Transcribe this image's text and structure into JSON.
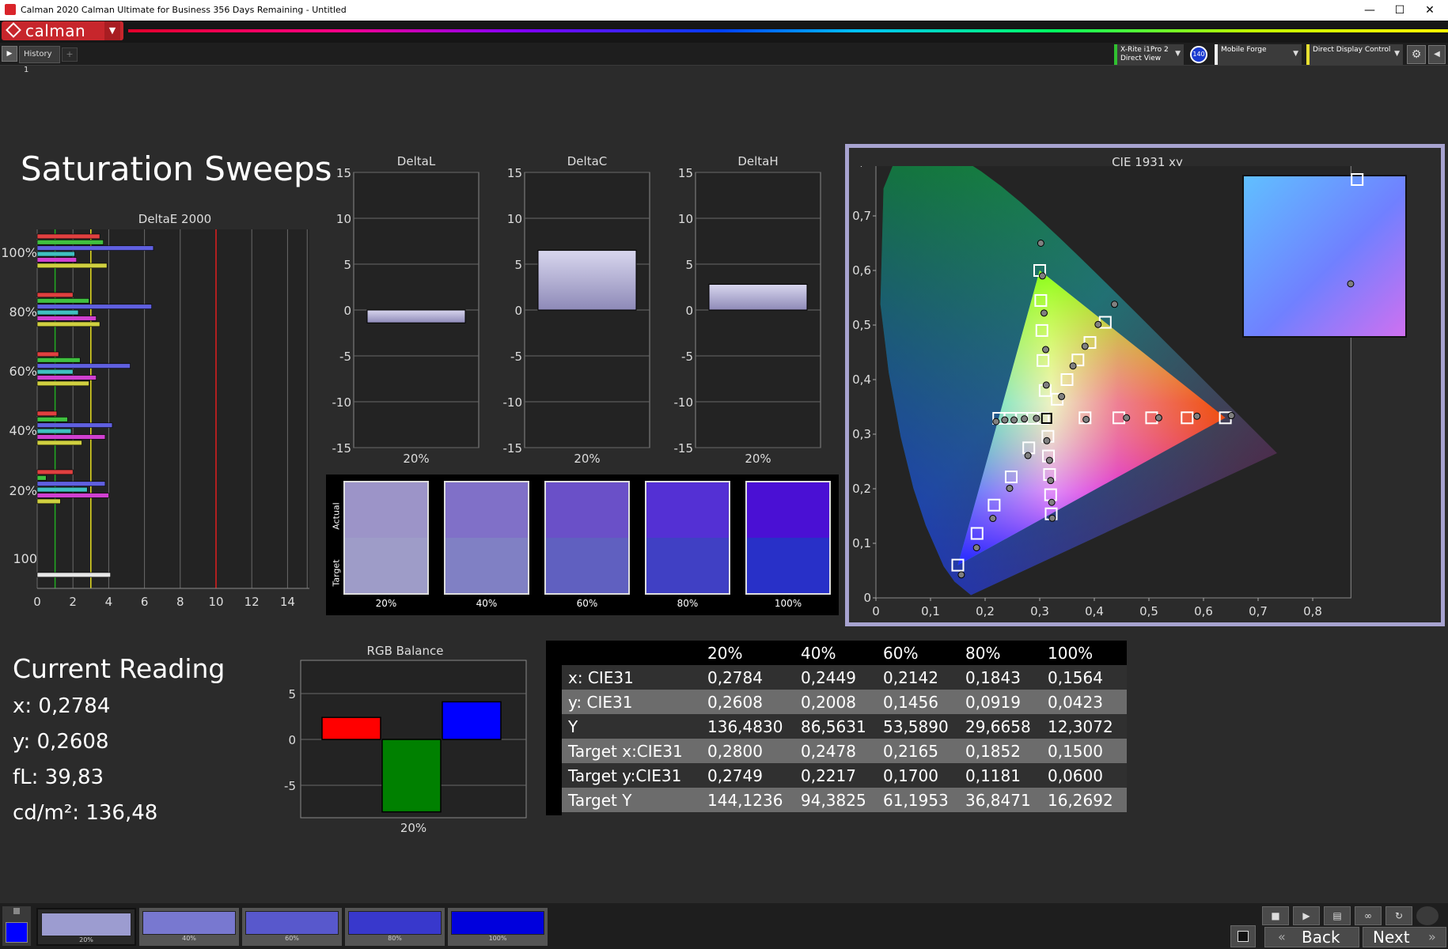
{
  "window": {
    "title": "Calman 2020 Calman Ultimate for Business 356 Days Remaining - Untitled",
    "minimize": "—",
    "maximize": "☐",
    "close": "✕"
  },
  "menubar": {
    "logo_text": "calman"
  },
  "tabbar": {
    "play": "▶",
    "tab_label": "History 1",
    "add": "+"
  },
  "devices": {
    "meter_line1": "X-Rite i1Pro 2",
    "meter_line2": "Direct View",
    "meter_badge": "140",
    "source": "Mobile Forge",
    "display": "Direct Display Control",
    "dropdown_glyph": "▼",
    "settings_glyph": "⚙",
    "collapse_glyph": "◀"
  },
  "page": {
    "title": "Saturation Sweeps"
  },
  "colors": {
    "accent_red": "#d9242a",
    "panel_border": "#a7a3d0",
    "target_swatch": "#0000ff"
  },
  "deltae_chart": {
    "title": "DeltaE 2000",
    "x_ticks": [
      "0",
      "2",
      "4",
      "6",
      "8",
      "10",
      "12",
      "14"
    ],
    "y_labels": [
      "100%",
      "80%",
      "60%",
      "40%",
      "20%",
      "100"
    ],
    "thresholds": [
      1,
      3,
      10
    ],
    "groups": [
      {
        "label": "100%",
        "bars": [
          {
            "c": "#e04040",
            "v": 3.5
          },
          {
            "c": "#40c040",
            "v": 3.7
          },
          {
            "c": "#6060e0",
            "v": 6.5
          },
          {
            "c": "#40c0c0",
            "v": 2.1
          },
          {
            "c": "#d040d0",
            "v": 2.2
          },
          {
            "c": "#d0d040",
            "v": 3.9
          }
        ]
      },
      {
        "label": "80%",
        "bars": [
          {
            "c": "#e04040",
            "v": 2.0
          },
          {
            "c": "#40c040",
            "v": 2.9
          },
          {
            "c": "#6060e0",
            "v": 6.4
          },
          {
            "c": "#40c0c0",
            "v": 2.3
          },
          {
            "c": "#d040d0",
            "v": 3.3
          },
          {
            "c": "#d0d040",
            "v": 3.5
          }
        ]
      },
      {
        "label": "60%",
        "bars": [
          {
            "c": "#e04040",
            "v": 1.2
          },
          {
            "c": "#40c040",
            "v": 2.4
          },
          {
            "c": "#6060e0",
            "v": 5.2
          },
          {
            "c": "#40c0c0",
            "v": 2.0
          },
          {
            "c": "#d040d0",
            "v": 3.3
          },
          {
            "c": "#d0d040",
            "v": 2.9
          }
        ]
      },
      {
        "label": "40%",
        "bars": [
          {
            "c": "#e04040",
            "v": 1.1
          },
          {
            "c": "#40c040",
            "v": 1.7
          },
          {
            "c": "#6060e0",
            "v": 4.2
          },
          {
            "c": "#40c0c0",
            "v": 1.9
          },
          {
            "c": "#d040d0",
            "v": 3.8
          },
          {
            "c": "#d0d040",
            "v": 2.5
          }
        ]
      },
      {
        "label": "20%",
        "bars": [
          {
            "c": "#e04040",
            "v": 2.0
          },
          {
            "c": "#40c040",
            "v": 0.5
          },
          {
            "c": "#6060e0",
            "v": 3.8
          },
          {
            "c": "#40c0c0",
            "v": 2.8
          },
          {
            "c": "#d040d0",
            "v": 4.0
          },
          {
            "c": "#d0d040",
            "v": 1.3
          }
        ]
      },
      {
        "label": "100",
        "bars": [
          {
            "c": "#e8e8e8",
            "v": 4.1
          }
        ]
      }
    ]
  },
  "delta_charts": [
    {
      "title": "DeltaL",
      "value": -1.4,
      "category": "20%",
      "y_ticks": [
        "15",
        "10",
        "5",
        "0",
        "-5",
        "-10",
        "-15"
      ]
    },
    {
      "title": "DeltaC",
      "value": 6.5,
      "category": "20%",
      "y_ticks": [
        "15",
        "10",
        "5",
        "0",
        "-5",
        "-10",
        "-15"
      ]
    },
    {
      "title": "DeltaH",
      "value": 2.8,
      "category": "20%",
      "y_ticks": [
        "15",
        "10",
        "5",
        "0",
        "-5",
        "-10",
        "-15"
      ]
    }
  ],
  "swatches": {
    "actual_label": "Actual",
    "target_label": "Target",
    "items": [
      {
        "label": "20%",
        "actual": "#9c94c8",
        "target": "#9e9cc8"
      },
      {
        "label": "40%",
        "actual": "#8070c8",
        "target": "#8080c4"
      },
      {
        "label": "60%",
        "actual": "#6a50c8",
        "target": "#6060c0"
      },
      {
        "label": "80%",
        "actual": "#5430d4",
        "target": "#4040c4"
      },
      {
        "label": "100%",
        "actual": "#4a10d4",
        "target": "#2830c8"
      }
    ]
  },
  "cie": {
    "title": "CIE 1931 xy",
    "x_ticks": [
      "0",
      "0,1",
      "0,2",
      "0,3",
      "0,4",
      "0,5",
      "0,6",
      "0,7",
      "0,8"
    ],
    "y_ticks": [
      "0",
      "0,1",
      "0,2",
      "0,3",
      "0,4",
      "0,5",
      "0,6",
      "0,7",
      "0,8"
    ],
    "gamut": [
      [
        0.64,
        0.33
      ],
      [
        0.3,
        0.6
      ],
      [
        0.15,
        0.06
      ]
    ],
    "white": [
      0.3127,
      0.329
    ],
    "targets": [
      [
        0.28,
        0.2749
      ],
      [
        0.2478,
        0.2217
      ],
      [
        0.2165,
        0.17
      ],
      [
        0.1852,
        0.1181
      ],
      [
        0.15,
        0.06
      ],
      [
        0.64,
        0.33
      ],
      [
        0.57,
        0.33
      ],
      [
        0.505,
        0.33
      ],
      [
        0.445,
        0.33
      ],
      [
        0.383,
        0.33
      ],
      [
        0.3,
        0.6
      ],
      [
        0.302,
        0.545
      ],
      [
        0.304,
        0.49
      ],
      [
        0.306,
        0.435
      ],
      [
        0.31,
        0.38
      ],
      [
        0.42,
        0.505
      ],
      [
        0.392,
        0.468
      ],
      [
        0.37,
        0.436
      ],
      [
        0.35,
        0.4
      ],
      [
        0.332,
        0.364
      ],
      [
        0.225,
        0.329
      ],
      [
        0.246,
        0.329
      ],
      [
        0.267,
        0.329
      ],
      [
        0.287,
        0.329
      ],
      [
        0.306,
        0.329
      ],
      [
        0.321,
        0.154
      ],
      [
        0.32,
        0.189
      ],
      [
        0.318,
        0.226
      ],
      [
        0.316,
        0.26
      ],
      [
        0.315,
        0.296
      ]
    ],
    "actuals": [
      [
        0.2784,
        0.2608
      ],
      [
        0.2449,
        0.2008
      ],
      [
        0.2142,
        0.1456
      ],
      [
        0.1843,
        0.0919
      ],
      [
        0.1564,
        0.0423
      ],
      [
        0.651,
        0.334
      ],
      [
        0.588,
        0.333
      ],
      [
        0.518,
        0.33
      ],
      [
        0.459,
        0.33
      ],
      [
        0.385,
        0.327
      ],
      [
        0.302,
        0.65
      ],
      [
        0.305,
        0.59
      ],
      [
        0.308,
        0.522
      ],
      [
        0.311,
        0.455
      ],
      [
        0.312,
        0.39
      ],
      [
        0.437,
        0.538
      ],
      [
        0.407,
        0.501
      ],
      [
        0.383,
        0.461
      ],
      [
        0.361,
        0.425
      ],
      [
        0.34,
        0.369
      ],
      [
        0.22,
        0.323
      ],
      [
        0.236,
        0.326
      ],
      [
        0.253,
        0.326
      ],
      [
        0.272,
        0.328
      ],
      [
        0.294,
        0.329
      ],
      [
        0.323,
        0.146
      ],
      [
        0.322,
        0.175
      ],
      [
        0.32,
        0.215
      ],
      [
        0.318,
        0.252
      ],
      [
        0.313,
        0.288
      ]
    ],
    "inset_target": [
      0.7,
      0.5
    ],
    "inset_actual": [
      0.66,
      0.28
    ]
  },
  "current_reading": {
    "title": "Current Reading",
    "x": "x: 0,2784",
    "y": "y: 0,2608",
    "fl": "fL: 39,83",
    "cdm2": "cd/m²: 136,48"
  },
  "rgb_balance": {
    "title": "RGB Balance",
    "category": "20%",
    "y_ticks": [
      "5",
      "0",
      "-5"
    ],
    "values": [
      2.4,
      -7.9,
      4.1
    ],
    "colors": [
      "#ff0000",
      "#008000",
      "#0000ff"
    ]
  },
  "table": {
    "headers": [
      "",
      "20%",
      "40%",
      "60%",
      "80%",
      "100%"
    ],
    "rows": [
      [
        "x: CIE31",
        "0,2784",
        "0,2449",
        "0,2142",
        "0,1843",
        "0,1564"
      ],
      [
        "y: CIE31",
        "0,2608",
        "0,2008",
        "0,1456",
        "0,0919",
        "0,0423"
      ],
      [
        "Y",
        "136,4830",
        "86,5631",
        "53,5890",
        "29,6658",
        "12,3072"
      ],
      [
        "Target x:CIE31",
        "0,2800",
        "0,2478",
        "0,2165",
        "0,1852",
        "0,1500"
      ],
      [
        "Target y:CIE31",
        "0,2749",
        "0,2217",
        "0,1700",
        "0,1181",
        "0,0600"
      ],
      [
        "Target Y",
        "144,1236",
        "94,3825",
        "61,1953",
        "36,8471",
        "16,2692"
      ]
    ]
  },
  "bottom": {
    "swatches": [
      {
        "label": "20%",
        "color": "#9c9cd0"
      },
      {
        "label": "40%",
        "color": "#7878d0"
      },
      {
        "label": "60%",
        "color": "#5858cc"
      },
      {
        "label": "80%",
        "color": "#3838cc"
      },
      {
        "label": "100%",
        "color": "#0000dd"
      }
    ],
    "back": "Back",
    "next": "Next",
    "ctl_stop": "■",
    "ctl_play": "▶",
    "ctl_save": "▤",
    "ctl_loop": "∞",
    "ctl_refresh": "↻",
    "back_arrow": "«",
    "next_arrow": "»"
  }
}
